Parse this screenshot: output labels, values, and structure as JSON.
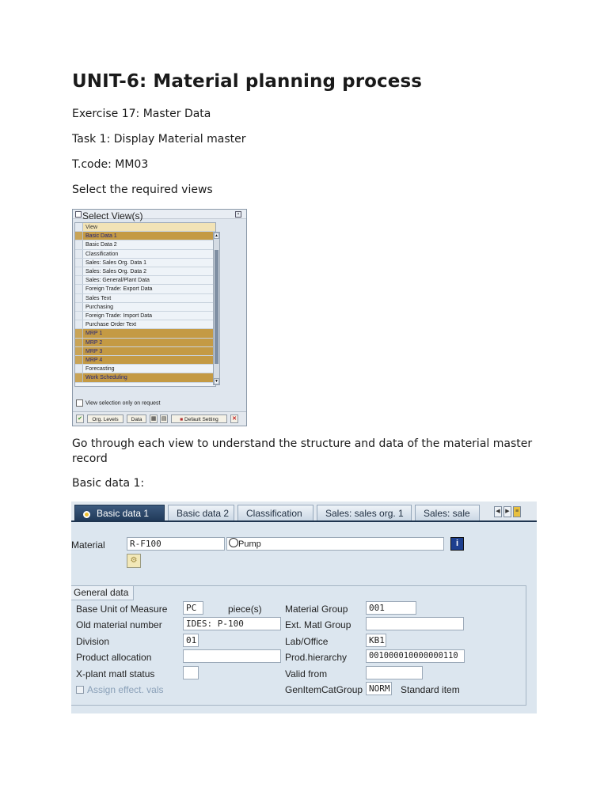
{
  "heading": "UNIT-6: Material planning process",
  "exercise": "Exercise 17: Master Data",
  "task": "Task 1: Display Material master",
  "tcode": "T.code: MM03",
  "select_views_text": "Select the required views",
  "dialog": {
    "title": "Select View(s)",
    "column_header": "View",
    "views": [
      {
        "label": "Basic Data 1",
        "selected": true
      },
      {
        "label": "Basic Data 2",
        "selected": false
      },
      {
        "label": "Classification",
        "selected": false
      },
      {
        "label": "Sales: Sales Org. Data 1",
        "selected": false
      },
      {
        "label": "Sales: Sales Org. Data 2",
        "selected": false
      },
      {
        "label": "Sales: General/Plant Data",
        "selected": false
      },
      {
        "label": "Foreign Trade: Export Data",
        "selected": false
      },
      {
        "label": "Sales Text",
        "selected": false
      },
      {
        "label": "Purchasing",
        "selected": false
      },
      {
        "label": "Foreign Trade: Import Data",
        "selected": false
      },
      {
        "label": "Purchase Order Text",
        "selected": false
      },
      {
        "label": "MRP 1",
        "selected": true
      },
      {
        "label": "MRP 2",
        "selected": true
      },
      {
        "label": "MRP 3",
        "selected": true
      },
      {
        "label": "MRP 4",
        "selected": true
      },
      {
        "label": "Forecasting",
        "selected": false
      },
      {
        "label": "Work Scheduling",
        "selected": true
      }
    ],
    "view_selection_checkbox": "View selection only on request",
    "buttons": {
      "org_levels": "Org. Levels",
      "data": "Data",
      "default_setting": "Default Setting"
    }
  },
  "go_through_text": "Go through each view to understand the structure and data of the material master record",
  "basic_data_heading": "Basic data 1:",
  "sap": {
    "tabs": [
      "Basic data 1",
      "Basic data 2",
      "Classification",
      "Sales: sales org. 1",
      "Sales: sale"
    ],
    "material_label": "Material",
    "material_value": "R-F100",
    "material_desc": "Pump",
    "group_title": "General data",
    "left_fields": [
      {
        "label": "Base Unit of Measure",
        "value": "PC",
        "extra": "piece(s)"
      },
      {
        "label": "Old material number",
        "value": "IDES: P-100"
      },
      {
        "label": "Division",
        "value": "01"
      },
      {
        "label": "Product allocation",
        "value": ""
      },
      {
        "label": "X-plant matl status",
        "value": ""
      }
    ],
    "assign_label": "Assign effect. vals",
    "right_fields": [
      {
        "label": "Material Group",
        "value": "001"
      },
      {
        "label": "Ext. Matl Group",
        "value": ""
      },
      {
        "label": "Lab/Office",
        "value": "KB1"
      },
      {
        "label": "Prod.hierarchy",
        "value": "001000010000000110"
      },
      {
        "label": "Valid from",
        "value": ""
      },
      {
        "label": "GenItemCatGroup",
        "value": "NORM",
        "extra": "Standard item"
      }
    ]
  }
}
